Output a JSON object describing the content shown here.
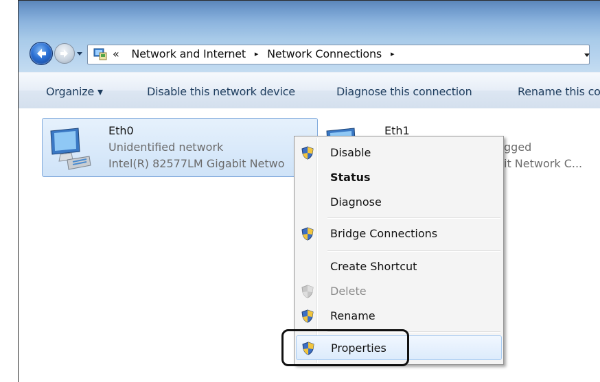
{
  "address_bar": {
    "overflow_glyph": "«",
    "crumbs": [
      "Network and Internet",
      "Network Connections"
    ],
    "separator": "▸"
  },
  "toolbar": {
    "organize_label": "Organize ▾",
    "disable_label": "Disable this network device",
    "diagnose_label": "Diagnose this connection",
    "rename_label": "Rename this co"
  },
  "connections": [
    {
      "name": "Eth0",
      "status": "Unidentified network",
      "adapter": "Intel(R) 82577LM Gigabit Netwo"
    },
    {
      "name": "Eth1",
      "status": "gged",
      "adapter": "it Network C..."
    }
  ],
  "context_menu": {
    "items": [
      {
        "label": "Disable",
        "icon": "uac-shield-icon"
      },
      {
        "label": "Status",
        "icon": ""
      },
      {
        "label": "Diagnose",
        "icon": ""
      },
      {
        "label": "Bridge Connections",
        "icon": "uac-shield-icon"
      },
      {
        "label": "Create Shortcut",
        "icon": ""
      },
      {
        "label": "Delete",
        "icon": "uac-shield-icon"
      },
      {
        "label": "Rename",
        "icon": "uac-shield-icon"
      },
      {
        "label": "Properties",
        "icon": "uac-shield-icon"
      }
    ]
  },
  "colors": {
    "accent": "#2a6fd3",
    "selection": "#cfe3f8",
    "menu_background": "#f4f4f4",
    "disabled_text": "#8a8a8a"
  }
}
